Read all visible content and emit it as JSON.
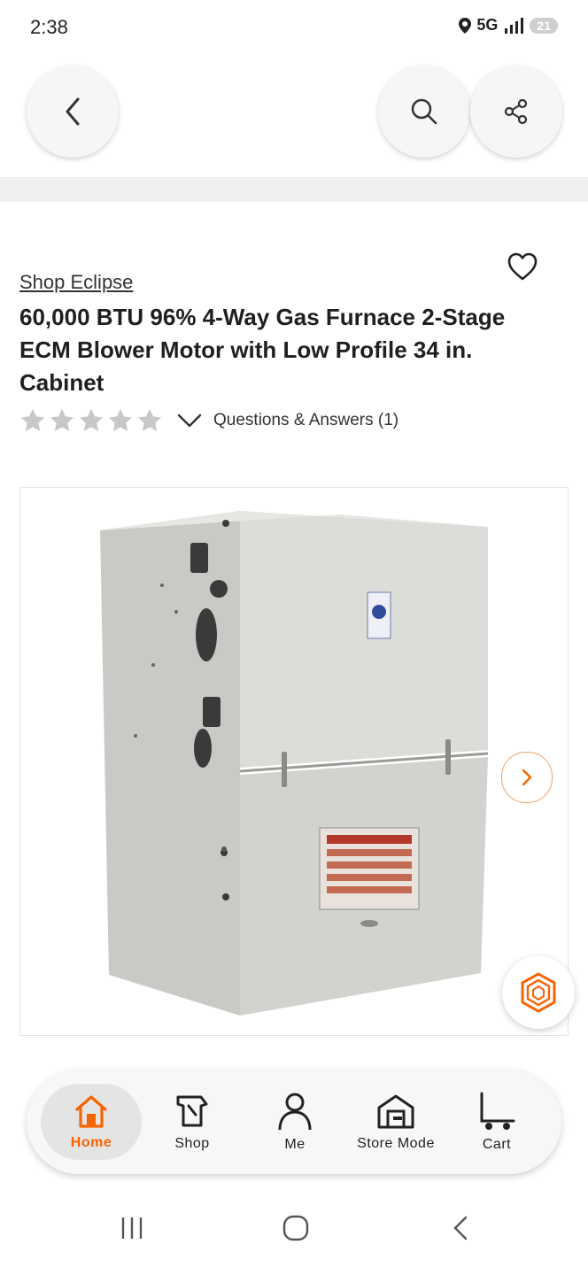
{
  "status_bar": {
    "time": "2:38",
    "network": "5G",
    "battery": "21"
  },
  "header": {
    "back_icon": "chevron-left-icon",
    "search_icon": "search-icon",
    "share_icon": "share-icon"
  },
  "product": {
    "brand_link": "Shop Eclipse",
    "title": "60,000 BTU 96% 4-Way Gas Furnace 2-Stage ECM Blower Motor with Low Profile 34 in. Cabinet",
    "rating_stars": 0,
    "rating_max": 5,
    "qa_link": "Questions & Answers (1)"
  },
  "bottom_nav": {
    "items": [
      {
        "label": "Home",
        "icon": "home-icon",
        "active": true
      },
      {
        "label": "Shop",
        "icon": "shop-icon",
        "active": false
      },
      {
        "label": "Me",
        "icon": "person-icon",
        "active": false
      },
      {
        "label": "Store Mode",
        "icon": "store-icon",
        "active": false
      },
      {
        "label": "Cart",
        "icon": "cart-icon",
        "active": false
      }
    ]
  },
  "colors": {
    "accent": "#f96302",
    "star_empty": "#c8c8c8"
  }
}
